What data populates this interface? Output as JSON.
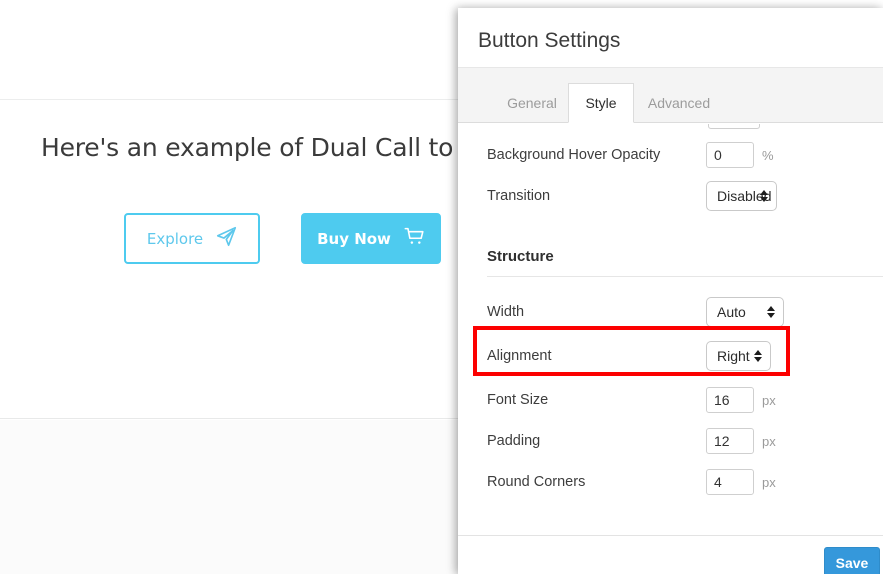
{
  "background_page": {
    "heading": "Here's an example of Dual Call to Action B",
    "buttons": [
      {
        "label": "Explore",
        "icon": "paper-plane-icon",
        "style": "outline",
        "color": "#4ecbef"
      },
      {
        "label": "Buy Now",
        "icon": "shopping-cart-icon",
        "style": "filled",
        "color": "#4ecbef"
      }
    ]
  },
  "modal": {
    "title": "Button Settings",
    "tabs": [
      {
        "label": "General",
        "active": false
      },
      {
        "label": "Style",
        "active": true
      },
      {
        "label": "Advanced",
        "active": false
      }
    ],
    "fields": [
      {
        "label": "Background Hover Opacity",
        "type": "number",
        "value": "0",
        "unit": "%"
      },
      {
        "label": "Transition",
        "type": "select",
        "value": "Disabled"
      }
    ],
    "sections": [
      {
        "heading": "Structure",
        "fields": [
          {
            "label": "Width",
            "type": "select",
            "value": "Auto"
          },
          {
            "label": "Alignment",
            "type": "select",
            "value": "Right",
            "highlighted": true
          },
          {
            "label": "Font Size",
            "type": "number",
            "value": "16",
            "unit": "px"
          },
          {
            "label": "Padding",
            "type": "number",
            "value": "12",
            "unit": "px"
          },
          {
            "label": "Round Corners",
            "type": "number",
            "value": "4",
            "unit": "px"
          }
        ]
      }
    ],
    "footer": {
      "save_label": "Save",
      "save_color": "#3598db"
    }
  },
  "annotation": {
    "color": "#fc0000",
    "target": "Alignment"
  }
}
